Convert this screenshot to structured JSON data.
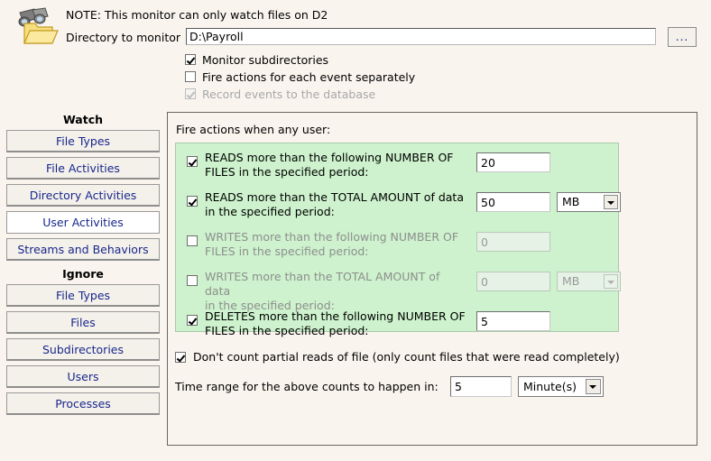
{
  "header": {
    "icon": "folder-monitor-icon",
    "note": "NOTE: This monitor can only watch files on D2",
    "directory_label": "Directory to monitor",
    "directory_value": "D:\\Payroll",
    "browse_label": "...",
    "options": [
      {
        "label": "Monitor subdirectories",
        "checked": true,
        "disabled": false
      },
      {
        "label": "Fire actions for each event separately",
        "checked": false,
        "disabled": false
      },
      {
        "label": "Record events to the database",
        "checked": true,
        "disabled": true
      }
    ]
  },
  "sidebar": {
    "watch_heading": "Watch",
    "watch_items": [
      {
        "label": "File Types",
        "active": false
      },
      {
        "label": "File Activities",
        "active": false
      },
      {
        "label": "Directory Activities",
        "active": false
      },
      {
        "label": "User Activities",
        "active": true
      },
      {
        "label": "Streams and Behaviors",
        "active": false
      }
    ],
    "ignore_heading": "Ignore",
    "ignore_items": [
      {
        "label": "File Types",
        "active": false
      },
      {
        "label": "Files",
        "active": false
      },
      {
        "label": "Subdirectories",
        "active": false
      },
      {
        "label": "Users",
        "active": false
      },
      {
        "label": "Processes",
        "active": false
      }
    ]
  },
  "main": {
    "title": "Fire actions when any user:",
    "rules": [
      {
        "line1": "READS more than the following NUMBER OF",
        "line2": "FILES in the specified period:",
        "checked": true,
        "disabled": false,
        "value": "20",
        "has_unit": false,
        "unit": ""
      },
      {
        "line1": "READS more than the TOTAL AMOUNT of data",
        "line2": "in the specified period:",
        "checked": true,
        "disabled": false,
        "value": "50",
        "has_unit": true,
        "unit": "MB"
      },
      {
        "line1": "WRITES more than the following NUMBER OF",
        "line2": "FILES in the specified period:",
        "checked": false,
        "disabled": true,
        "value": "0",
        "has_unit": false,
        "unit": ""
      },
      {
        "line1": "WRITES more than the TOTAL AMOUNT of data",
        "line2": "in the specified period:",
        "checked": false,
        "disabled": true,
        "value": "0",
        "has_unit": true,
        "unit": "MB"
      },
      {
        "line1": "DELETES more than the following NUMBER OF",
        "line2": "FILES in the specified period:",
        "checked": true,
        "disabled": false,
        "value": "5",
        "has_unit": false,
        "unit": ""
      }
    ],
    "partial_reads": {
      "label": "Don't count partial reads of file (only count files that were read completely)",
      "checked": true
    },
    "time_range": {
      "label": "Time range for the above counts to happen in:",
      "value": "5",
      "unit": "Minute(s)"
    }
  },
  "colors": {
    "page_background": "#f9f4ee",
    "rules_box_background": "#cdf2cd",
    "button_text": "#18288c",
    "panel_border": "#6b6660"
  }
}
